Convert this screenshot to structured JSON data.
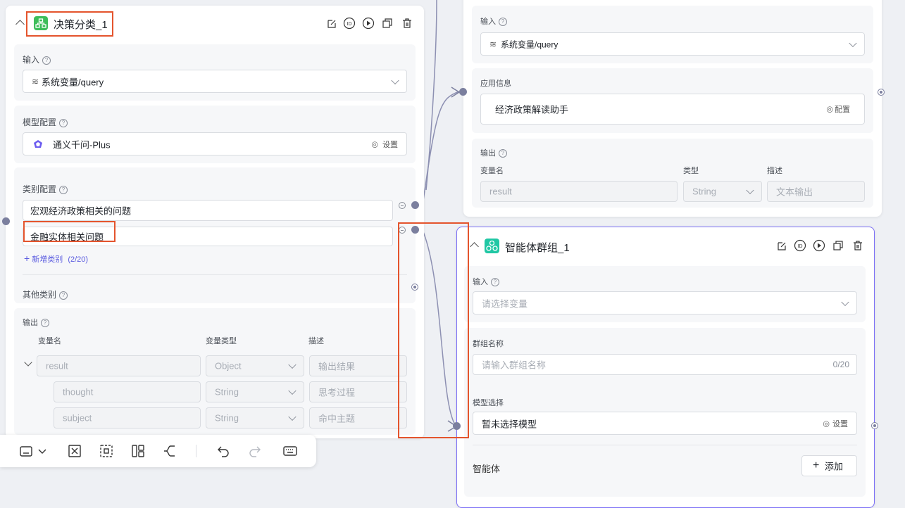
{
  "node1": {
    "title": "决策分类_1",
    "input": {
      "label": "输入",
      "value": "系统变量/query"
    },
    "model": {
      "label": "模型配置",
      "value": "通义千问-Plus",
      "action": "设置"
    },
    "categories": {
      "label": "类别配置",
      "items": [
        "宏观经济政策相关的问题",
        "金融实体相关问题"
      ],
      "add_label": "新增类别",
      "add_count": "(2/20)"
    },
    "other": {
      "label": "其他类别"
    },
    "output": {
      "label": "输出",
      "headers": [
        "变量名",
        "变量类型",
        "描述"
      ],
      "rows": [
        {
          "name": "result",
          "type": "Object",
          "desc": "输出结果"
        },
        {
          "name": "thought",
          "type": "String",
          "desc": "思考过程"
        },
        {
          "name": "subject",
          "type": "String",
          "desc": "命中主题"
        }
      ]
    }
  },
  "node2": {
    "input": {
      "label": "输入",
      "value": "系统变量/query"
    },
    "app": {
      "label": "应用信息",
      "value": "经济政策解读助手",
      "action": "配置"
    },
    "output": {
      "label": "输出",
      "headers": [
        "变量名",
        "类型",
        "描述"
      ],
      "row": {
        "name": "result",
        "type": "String",
        "desc": "文本输出"
      }
    }
  },
  "node3": {
    "title": "智能体群组_1",
    "input": {
      "label": "输入",
      "placeholder": "请选择变量"
    },
    "group_name": {
      "label": "群组名称",
      "placeholder": "请输入群组名称",
      "counter": "0/20"
    },
    "model": {
      "label": "模型选择",
      "value": "暂未选择模型",
      "action": "设置"
    },
    "agents": {
      "label": "智能体",
      "add": "添加"
    }
  },
  "colors": {
    "accent": "#7b6ef6",
    "highlight": "#e4542d",
    "connector": "#7b7f9e"
  }
}
